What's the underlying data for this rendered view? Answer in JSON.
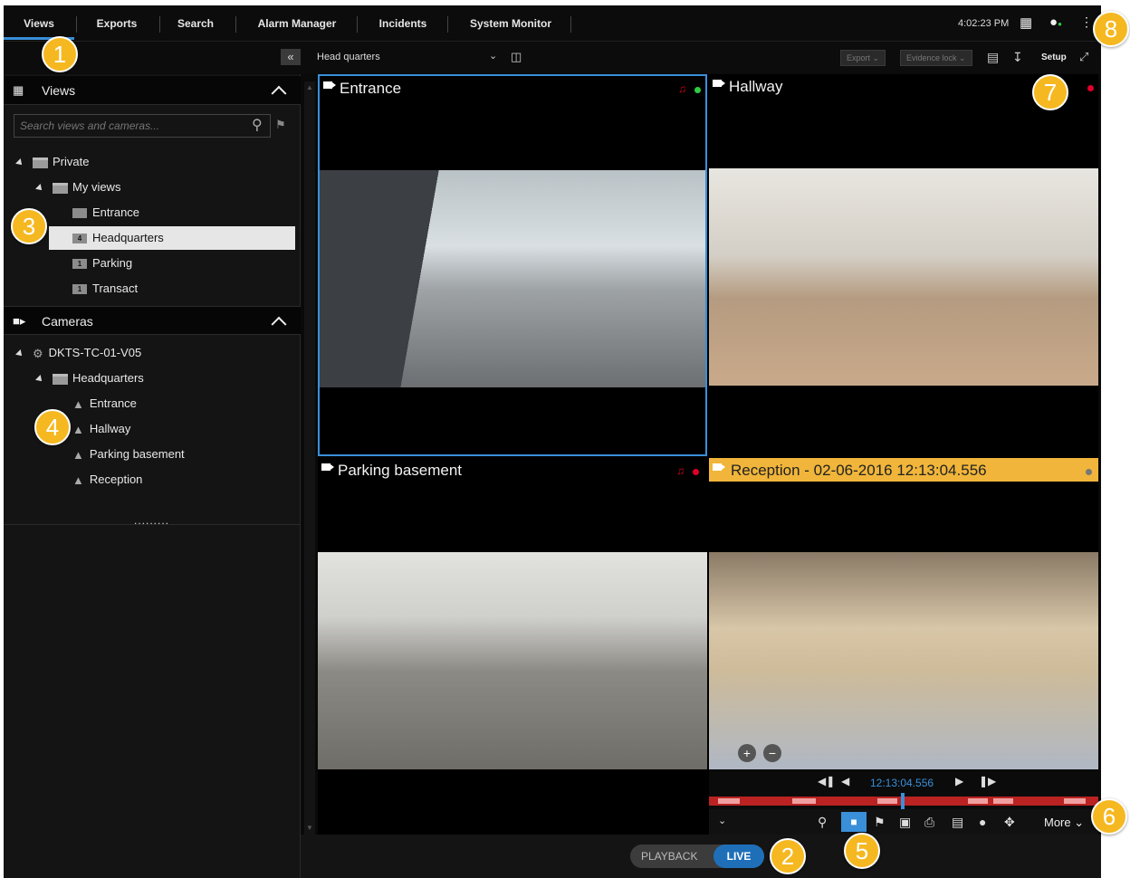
{
  "nav": {
    "tabs": [
      "Views",
      "Exports",
      "Search",
      "Alarm Manager",
      "Incidents",
      "System Monitor"
    ],
    "clock": "4:02:23 PM"
  },
  "toolbar": {
    "collapse": "«",
    "view_select": "Head quarters",
    "export_label": "Export",
    "evidence_lock_label": "Evidence lock",
    "setup_label": "Setup"
  },
  "views_panel": {
    "title": "Views",
    "search_placeholder": "Search views and cameras...",
    "tree": [
      {
        "label": "Private"
      },
      {
        "label": "My views"
      },
      {
        "label": "Entrance"
      },
      {
        "label": "Headquarters",
        "badge": "4"
      },
      {
        "label": "Parking",
        "badge": "1"
      },
      {
        "label": "Transact",
        "badge": "1"
      }
    ]
  },
  "cameras_panel": {
    "title": "Cameras",
    "tree": [
      {
        "label": "DKTS-TC-01-V05"
      },
      {
        "label": "Headquarters"
      },
      {
        "label": "Entrance"
      },
      {
        "label": "Hallway"
      },
      {
        "label": "Parking basement"
      },
      {
        "label": "Reception"
      }
    ],
    "more": "........."
  },
  "tiles": {
    "entrance": {
      "title": "Entrance"
    },
    "hallway": {
      "title": "Hallway"
    },
    "parking": {
      "title": "Parking basement"
    },
    "reception": {
      "title": "Reception - 02-06-2016 12:13:04.556"
    }
  },
  "playback": {
    "time": "12:13:04.556",
    "more_label": "More"
  },
  "mode": {
    "playback_label": "PLAYBACK",
    "live_label": "LIVE"
  },
  "callouts": [
    "1",
    "2",
    "3",
    "4",
    "5",
    "6",
    "7",
    "8"
  ],
  "colors": {
    "accent": "#3a8fd9",
    "callout": "#f5b820",
    "recording": "#e0002a",
    "motion": "#d01",
    "reception_bar": "#f0b53a"
  }
}
